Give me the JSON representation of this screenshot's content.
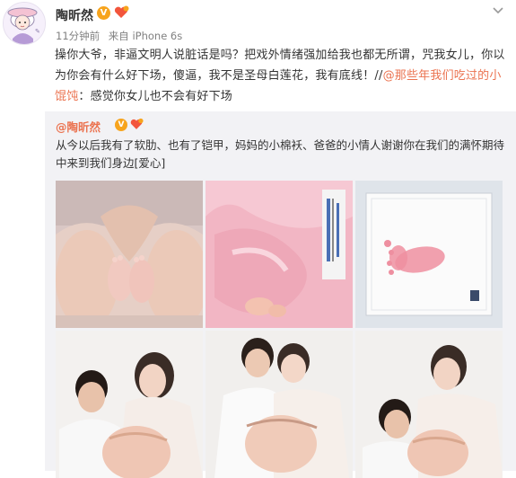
{
  "post": {
    "username": "陶昕然",
    "verified_badge": "V",
    "time": "11分钟前",
    "source": "来自 iPhone 6s",
    "text_part1": "操你大爷，非逼文明人说脏话是吗？把戏外情绪强加给我也都无所谓，咒我女儿，你以为你会有什么好下场，傻逼，我不是圣母白莲花，我有底线！//",
    "mention": "@那些年我们吃过的小馄饨",
    "text_part2": "：感觉你女儿也不会有好下场"
  },
  "repost": {
    "mention": "@陶昕然",
    "verified_badge": "V",
    "text": "从今以后我有了软肋、也有了铠甲，妈妈的小棉袄、爸爸的小情人谢谢你在我们的满怀期待中来到我们身边[爱心]"
  },
  "icons": {
    "avatar": "cartoon-avatar",
    "verified": "verified-v-icon",
    "fan": "fan-heart-icon",
    "menu": "chevron-down-icon"
  },
  "colors": {
    "link": "#eb7350",
    "verified": "#f7a41d",
    "repost_bg": "#f2f2f5"
  }
}
